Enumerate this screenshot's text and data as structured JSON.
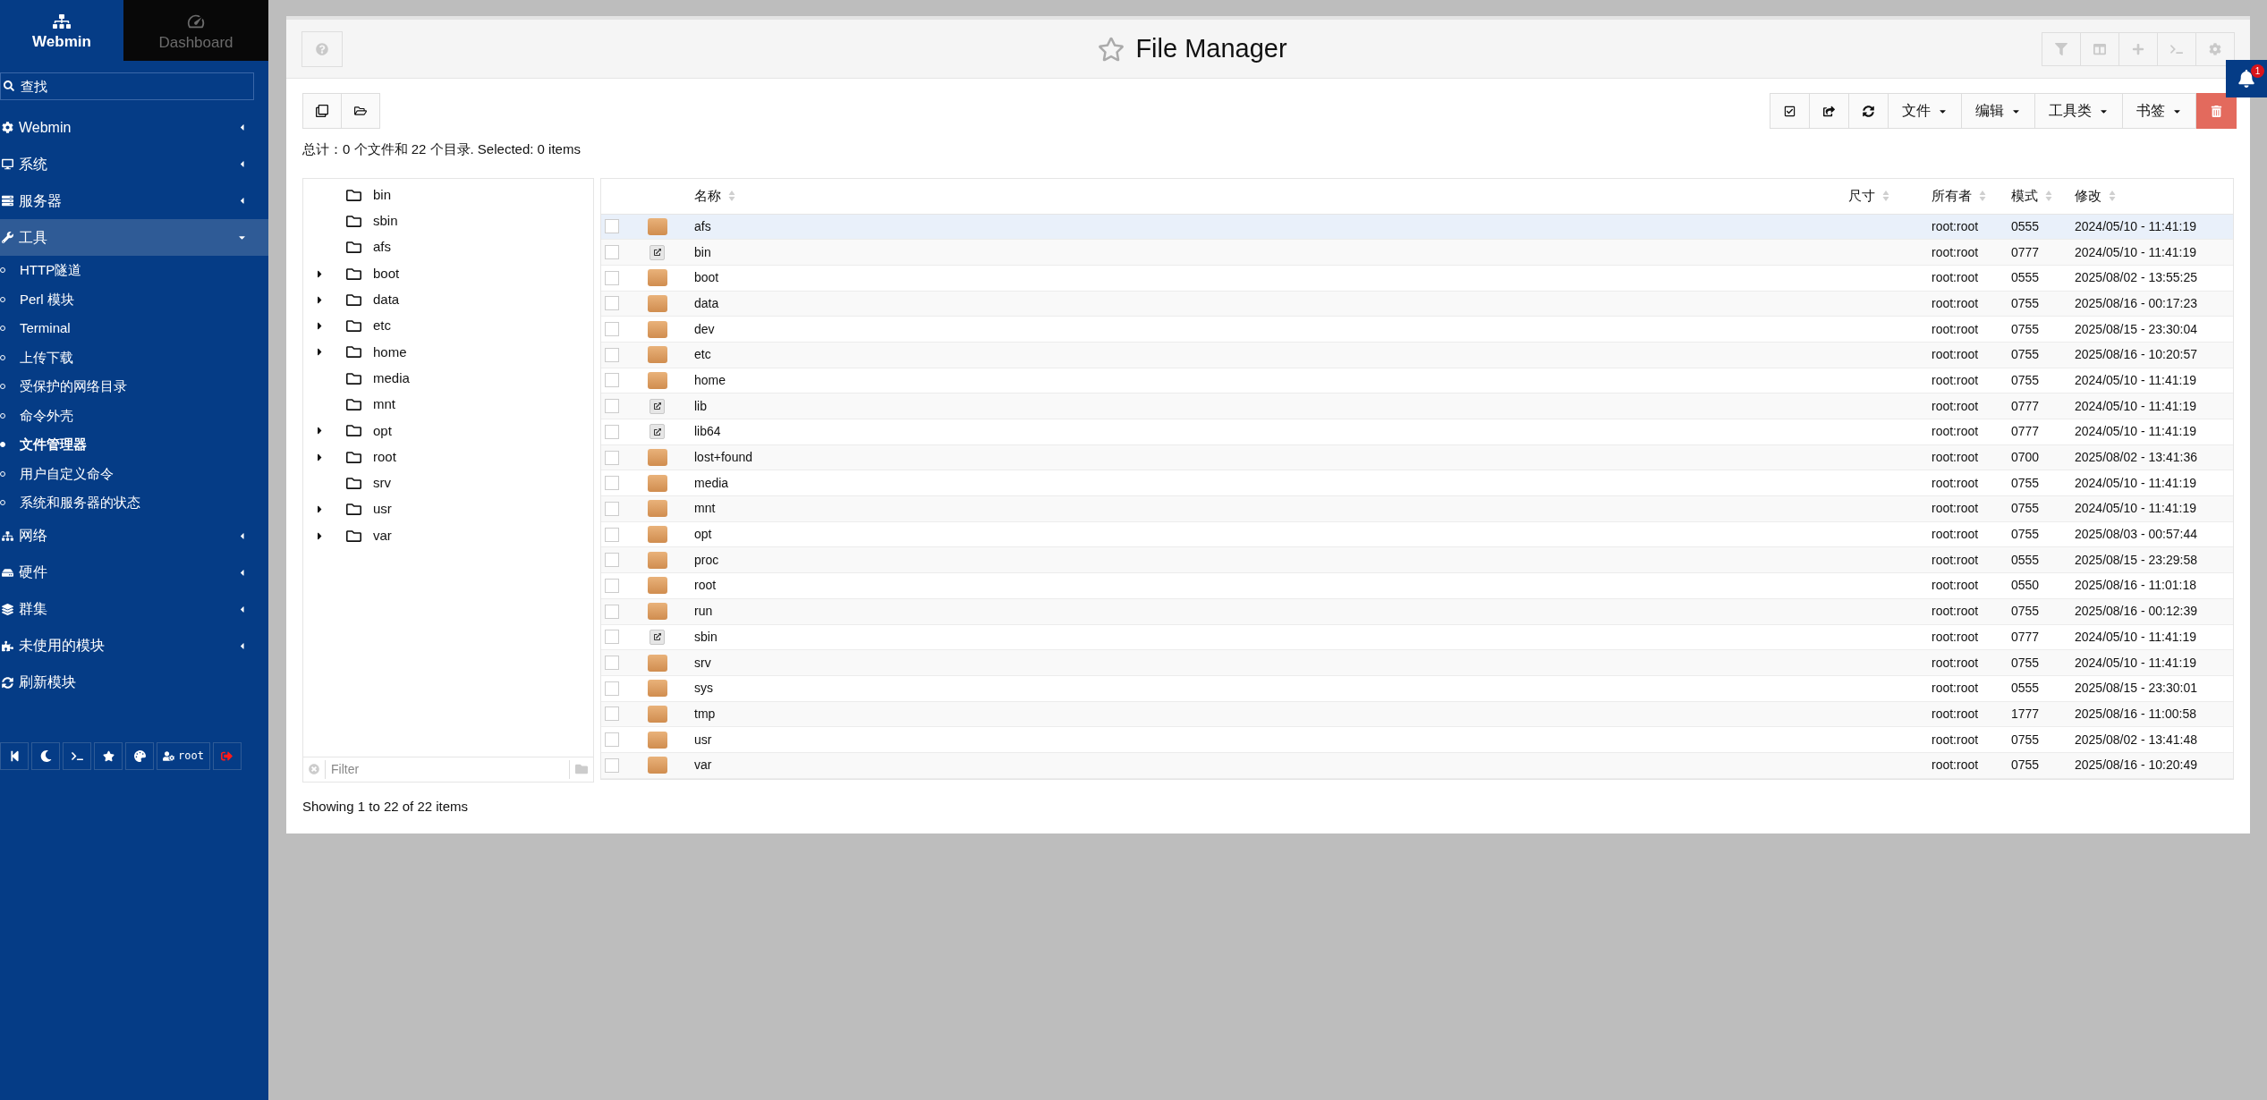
{
  "sidebar": {
    "tabs": [
      {
        "label": "Webmin",
        "selected": true
      },
      {
        "label": "Dashboard",
        "selected": false
      }
    ],
    "search": {
      "placeholder": "查找"
    },
    "items": [
      {
        "label": "Webmin",
        "expanded": false
      },
      {
        "label": "系统",
        "expanded": false
      },
      {
        "label": "服务器",
        "expanded": false
      },
      {
        "label": "工具",
        "expanded": true,
        "children": [
          {
            "label": "HTTP隧道",
            "selected": false
          },
          {
            "label": "Perl 模块",
            "selected": false
          },
          {
            "label": "Terminal",
            "selected": false
          },
          {
            "label": "上传下载",
            "selected": false
          },
          {
            "label": "受保护的网络目录",
            "selected": false
          },
          {
            "label": "命令外壳",
            "selected": false
          },
          {
            "label": "文件管理器",
            "selected": true
          },
          {
            "label": "用户自定义命令",
            "selected": false
          },
          {
            "label": "系统和服务器的状态",
            "selected": false
          }
        ]
      },
      {
        "label": "网络",
        "expanded": false
      },
      {
        "label": "硬件",
        "expanded": false
      },
      {
        "label": "群集",
        "expanded": false
      },
      {
        "label": "未使用的模块",
        "expanded": false
      },
      {
        "label": "刷新模块",
        "expanded": false
      }
    ],
    "user": "root"
  },
  "title": "File Manager",
  "menus": [
    "文件",
    "编辑",
    "工具类",
    "书签"
  ],
  "summary": "总计：0 个文件和 22 个目录. Selected: 0 items",
  "tree": [
    {
      "label": "bin",
      "has_children": false
    },
    {
      "label": "sbin",
      "has_children": false
    },
    {
      "label": "afs",
      "has_children": false
    },
    {
      "label": "boot",
      "has_children": true
    },
    {
      "label": "data",
      "has_children": true
    },
    {
      "label": "etc",
      "has_children": true
    },
    {
      "label": "home",
      "has_children": true
    },
    {
      "label": "media",
      "has_children": false
    },
    {
      "label": "mnt",
      "has_children": false
    },
    {
      "label": "opt",
      "has_children": true
    },
    {
      "label": "root",
      "has_children": true
    },
    {
      "label": "srv",
      "has_children": false
    },
    {
      "label": "usr",
      "has_children": true
    },
    {
      "label": "var",
      "has_children": true
    }
  ],
  "filter": {
    "placeholder": "Filter"
  },
  "table": {
    "columns": [
      "名称",
      "尺寸",
      "所有者",
      "模式",
      "修改"
    ],
    "rows": [
      {
        "kind": "folder",
        "name": "afs",
        "owner": "root:root",
        "mode": "0555",
        "modified": "2024/05/10 - 11:41:19",
        "checked": false,
        "highlighted": true
      },
      {
        "kind": "link",
        "name": "bin",
        "owner": "root:root",
        "mode": "0777",
        "modified": "2024/05/10 - 11:41:19",
        "checked": false,
        "highlighted": false
      },
      {
        "kind": "folder",
        "name": "boot",
        "owner": "root:root",
        "mode": "0555",
        "modified": "2025/08/02 - 13:55:25",
        "checked": false,
        "highlighted": false
      },
      {
        "kind": "folder",
        "name": "data",
        "owner": "root:root",
        "mode": "0755",
        "modified": "2025/08/16 - 00:17:23",
        "checked": false,
        "highlighted": false
      },
      {
        "kind": "folder",
        "name": "dev",
        "owner": "root:root",
        "mode": "0755",
        "modified": "2025/08/15 - 23:30:04",
        "checked": false,
        "highlighted": false
      },
      {
        "kind": "folder",
        "name": "etc",
        "owner": "root:root",
        "mode": "0755",
        "modified": "2025/08/16 - 10:20:57",
        "checked": false,
        "highlighted": false
      },
      {
        "kind": "folder",
        "name": "home",
        "owner": "root:root",
        "mode": "0755",
        "modified": "2024/05/10 - 11:41:19",
        "checked": false,
        "highlighted": false
      },
      {
        "kind": "link",
        "name": "lib",
        "owner": "root:root",
        "mode": "0777",
        "modified": "2024/05/10 - 11:41:19",
        "checked": false,
        "highlighted": false
      },
      {
        "kind": "link",
        "name": "lib64",
        "owner": "root:root",
        "mode": "0777",
        "modified": "2024/05/10 - 11:41:19",
        "checked": false,
        "highlighted": false
      },
      {
        "kind": "folder",
        "name": "lost+found",
        "owner": "root:root",
        "mode": "0700",
        "modified": "2025/08/02 - 13:41:36",
        "checked": false,
        "highlighted": false
      },
      {
        "kind": "folder",
        "name": "media",
        "owner": "root:root",
        "mode": "0755",
        "modified": "2024/05/10 - 11:41:19",
        "checked": false,
        "highlighted": false
      },
      {
        "kind": "folder",
        "name": "mnt",
        "owner": "root:root",
        "mode": "0755",
        "modified": "2024/05/10 - 11:41:19",
        "checked": false,
        "highlighted": false
      },
      {
        "kind": "folder",
        "name": "opt",
        "owner": "root:root",
        "mode": "0755",
        "modified": "2025/08/03 - 00:57:44",
        "checked": false,
        "highlighted": false
      },
      {
        "kind": "folder",
        "name": "proc",
        "owner": "root:root",
        "mode": "0555",
        "modified": "2025/08/15 - 23:29:58",
        "checked": false,
        "highlighted": false
      },
      {
        "kind": "folder",
        "name": "root",
        "owner": "root:root",
        "mode": "0550",
        "modified": "2025/08/16 - 11:01:18",
        "checked": false,
        "highlighted": false
      },
      {
        "kind": "folder",
        "name": "run",
        "owner": "root:root",
        "mode": "0755",
        "modified": "2025/08/16 - 00:12:39",
        "checked": false,
        "highlighted": false
      },
      {
        "kind": "link",
        "name": "sbin",
        "owner": "root:root",
        "mode": "0777",
        "modified": "2024/05/10 - 11:41:19",
        "checked": false,
        "highlighted": false
      },
      {
        "kind": "folder",
        "name": "srv",
        "owner": "root:root",
        "mode": "0755",
        "modified": "2024/05/10 - 11:41:19",
        "checked": false,
        "highlighted": false
      },
      {
        "kind": "folder",
        "name": "sys",
        "owner": "root:root",
        "mode": "0555",
        "modified": "2025/08/15 - 23:30:01",
        "checked": false,
        "highlighted": false
      },
      {
        "kind": "folder",
        "name": "tmp",
        "owner": "root:root",
        "mode": "1777",
        "modified": "2025/08/16 - 11:00:58",
        "checked": false,
        "highlighted": false
      },
      {
        "kind": "folder",
        "name": "usr",
        "owner": "root:root",
        "mode": "0755",
        "modified": "2025/08/02 - 13:41:48",
        "checked": false,
        "highlighted": false
      },
      {
        "kind": "folder",
        "name": "var",
        "owner": "root:root",
        "mode": "0755",
        "modified": "2025/08/16 - 10:20:49",
        "checked": false,
        "highlighted": false
      }
    ]
  },
  "footer": "Showing 1 to 22 of 22 items",
  "notifications": {
    "count": "1"
  }
}
